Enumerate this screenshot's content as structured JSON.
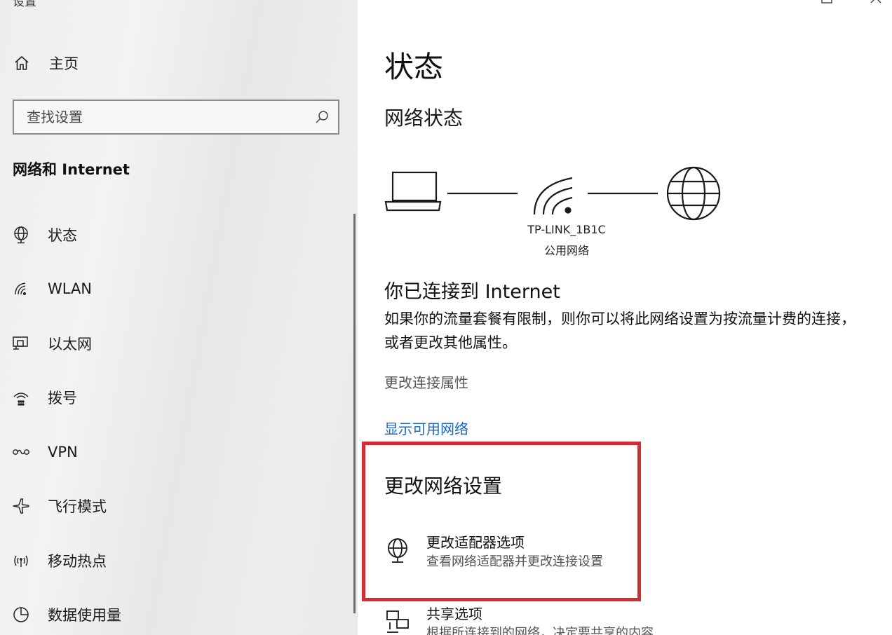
{
  "window": {
    "title": "设置"
  },
  "sidebar": {
    "home_label": "主页",
    "search_placeholder": "查找设置",
    "section_title": "网络和 Internet",
    "items": [
      {
        "label": "状态",
        "icon": "globe-stand-icon"
      },
      {
        "label": "WLAN",
        "icon": "wifi-icon"
      },
      {
        "label": "以太网",
        "icon": "ethernet-icon"
      },
      {
        "label": "拨号",
        "icon": "dialup-icon"
      },
      {
        "label": "VPN",
        "icon": "vpn-icon"
      },
      {
        "label": "飞行模式",
        "icon": "airplane-icon"
      },
      {
        "label": "移动热点",
        "icon": "hotspot-icon"
      },
      {
        "label": "数据使用量",
        "icon": "data-usage-icon"
      }
    ]
  },
  "main": {
    "page_title": "状态",
    "network_status_title": "网络状态",
    "network": {
      "ssid": "TP-LINK_1B1C",
      "type": "公用网络"
    },
    "connected_title": "你已连接到 Internet",
    "connected_desc": "如果你的流量套餐有限制，则你可以将此网络设置为按流量计费的连接，或者更改其他属性。",
    "change_connection_link": "更改连接属性",
    "show_networks_link": "显示可用网络",
    "change_settings_title": "更改网络设置",
    "options": [
      {
        "title": "更改适配器选项",
        "subtitle": "查看网络适配器并更改连接设置",
        "icon": "adapter-icon"
      },
      {
        "title": "共享选项",
        "subtitle": "根据所连接到的网络，决定要共享的内容",
        "icon": "sharing-icon"
      }
    ]
  },
  "colors": {
    "accent_link": "#1769c2",
    "highlight_border": "#d32c35"
  }
}
